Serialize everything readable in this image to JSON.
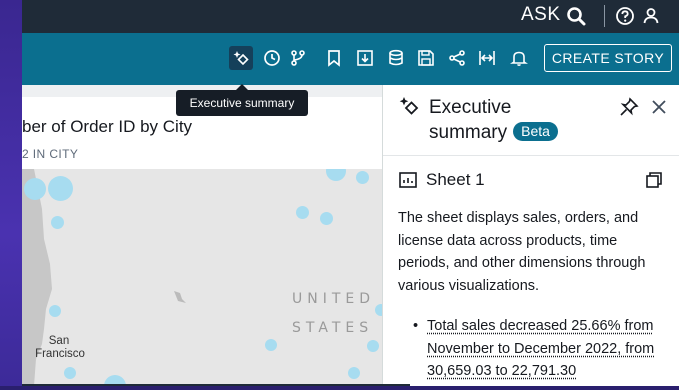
{
  "topbar": {
    "ask_label": "ASK",
    "icons": [
      "search-icon",
      "help-icon",
      "user-icon"
    ]
  },
  "toolbar": {
    "icons": [
      "executive-summary-icon",
      "history-icon",
      "branch-icon",
      "bookmark-icon",
      "download-icon",
      "dataset-icon",
      "save-icon",
      "share-icon",
      "fit-width-icon",
      "bell-icon"
    ],
    "create_story_label": "CREATE STORY"
  },
  "tooltip": {
    "text": "Executive summary"
  },
  "visual": {
    "title": "ber of Order ID by City",
    "subtitle": "2 IN CITY",
    "map": {
      "country_label_line1": "UNITED",
      "country_label_line2": "STATES",
      "city_label_line1": "San",
      "city_label_line2": "Francisco"
    }
  },
  "panel": {
    "title_line1": "Executive",
    "title_line2": "summary",
    "beta_label": "Beta",
    "sheet_label": "Sheet 1",
    "summary_text": "The sheet displays sales, orders, and license data across products, time periods, and other dimensions through various visualizations.",
    "bullet_text": "Total sales decreased 25.66% from November to December 2022, from 30,659.03 to 22,791.30"
  },
  "colors": {
    "topbar": "#1f2b38",
    "toolbar": "#0b6f8f",
    "accent": "#0b6f8f",
    "frame": "#3b2a8c",
    "map_dot": "#a7dcf0"
  }
}
